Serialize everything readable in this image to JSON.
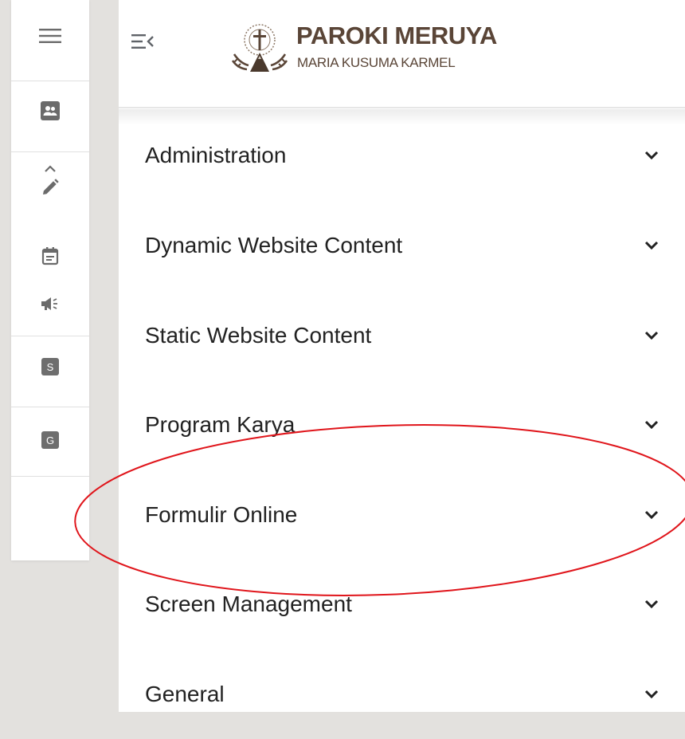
{
  "brand": {
    "title": "PAROKI MERUYA",
    "subtitle": "MARIA KUSUMA KARMEL",
    "text_color": "#5a4537"
  },
  "rail": {
    "icons": [
      "menu-icon",
      "people-icon",
      "chevron-up-icon",
      "pencil-icon",
      "calendar-icon",
      "megaphone-icon"
    ],
    "badges": [
      "S",
      "G"
    ]
  },
  "menu": {
    "items": [
      {
        "label": "Administration"
      },
      {
        "label": "Dynamic Website Content"
      },
      {
        "label": "Static Website Content"
      },
      {
        "label": "Program Karya"
      },
      {
        "label": "Formulir Online"
      },
      {
        "label": "Screen Management"
      },
      {
        "label": "General"
      }
    ]
  },
  "annotation": {
    "shape": "ellipse",
    "color": "#e0151b",
    "target": "Formulir Online"
  }
}
